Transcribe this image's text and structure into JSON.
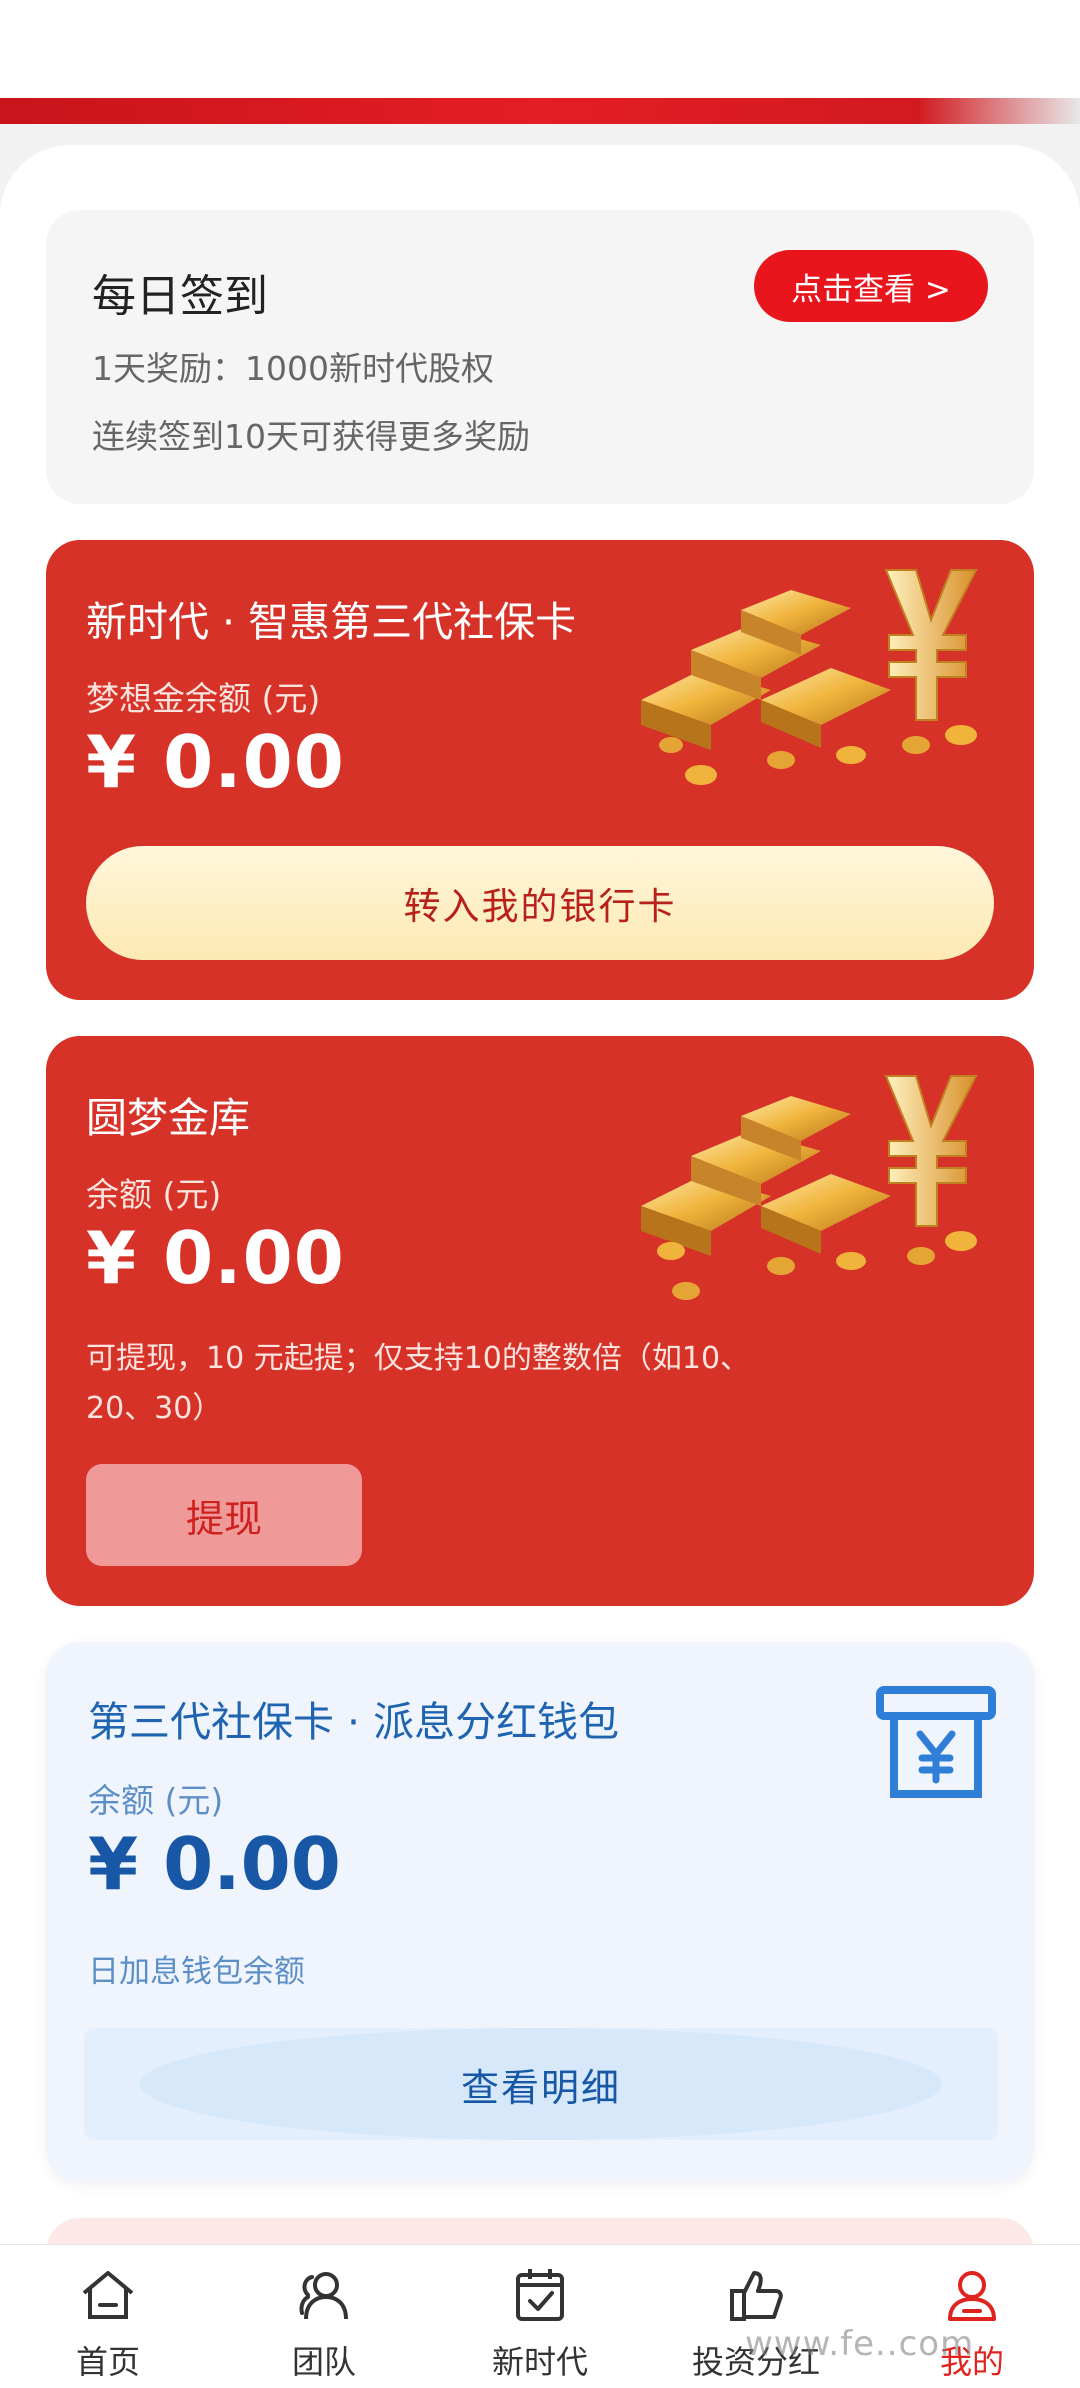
{
  "signin": {
    "title": "每日签到",
    "button": "点击查看 >",
    "line1": "1天奖励：1000新时代股权",
    "line2": "连续签到10天可获得更多奖励"
  },
  "card1": {
    "title": "新时代 · 智惠第三代社保卡",
    "sub": "梦想金余额 (元)",
    "amount": "¥ 0.00",
    "button": "转入我的银行卡"
  },
  "card2": {
    "title": "圆梦金库",
    "sub": "余额 (元)",
    "amount": "¥ 0.00",
    "note": "可提现，10 元起提；仅支持10的整数倍（如10、20、30）",
    "button": "提现"
  },
  "card3": {
    "title": "第三代社保卡 · 派息分红钱包",
    "sub": "余额 (元)",
    "amount": "¥ 0.00",
    "note": "日加息钱包余额",
    "button": "查看明细"
  },
  "nav": {
    "items": [
      {
        "label": "首页",
        "icon": "home-icon"
      },
      {
        "label": "团队",
        "icon": "team-icon"
      },
      {
        "label": "新时代",
        "icon": "calendar-check-icon"
      },
      {
        "label": "投资分红",
        "icon": "thumbs-up-icon"
      },
      {
        "label": "我的",
        "icon": "user-icon"
      }
    ],
    "active_index": 4
  },
  "watermark": "www.fe..com",
  "colors": {
    "brand_red": "#e8161c",
    "card_red": "#d63228",
    "blue_text": "#1857a6",
    "gold": "#f0b43c"
  }
}
